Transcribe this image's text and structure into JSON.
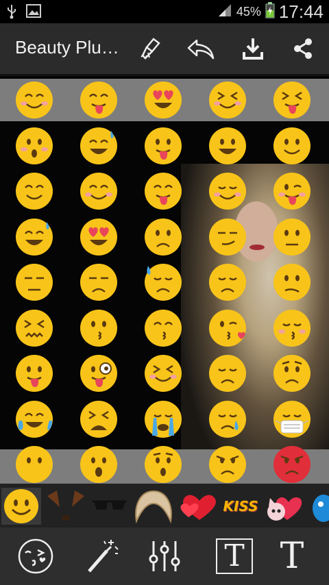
{
  "status_bar": {
    "battery_percent": "45%",
    "time": "17:44"
  },
  "app_bar": {
    "title": "Beauty Plu…",
    "actions": [
      "eraser-icon",
      "undo-icon",
      "download-icon",
      "share-icon"
    ]
  },
  "emoji_grid": {
    "rows": 9,
    "columns": 5,
    "items": [
      "blush-smile",
      "yum",
      "heart-eyes",
      "squint-tongue",
      "squint-tongue-out",
      "surprised",
      "sweat-smile",
      "tongue-out",
      "big-grin",
      "slight-smile",
      "smile",
      "blush",
      "yum",
      "relieved",
      "wink-tongue",
      "sweat-grin",
      "heart-eyes",
      "frown",
      "smirk",
      "neutral",
      "expressionless",
      "unamused",
      "downcast-sweat",
      "pensive",
      "confused",
      "confounded",
      "kissing",
      "kissing-smile",
      "kiss-heart",
      "kiss-blush",
      "tongue",
      "zany",
      "squint-tongue",
      "disappointed",
      "worried",
      "joy",
      "tired",
      "sob",
      "sleepy",
      "mask",
      "no-mouth",
      "open-mouth",
      "hushed",
      "angry",
      "pouting"
    ]
  },
  "sticker_strip": {
    "items": [
      "smiley-emoji",
      "dog-ears",
      "sunglasses",
      "hair-wig",
      "red-hearts",
      "kiss-text",
      "cartoon-cats",
      "blue-creature"
    ],
    "kiss_label": "KISS"
  },
  "bottom_toolbar": {
    "tools": [
      "emoji-face-tool",
      "magic-wand-tool",
      "adjust-sliders-tool",
      "text-box-tool",
      "text-tool"
    ],
    "text_glyph": "T"
  },
  "colors": {
    "appbar": "#2b2b2b",
    "emoji_yellow": "#f8c419",
    "band": "#7d7d7d",
    "pouting_red": "#e02e3a"
  }
}
